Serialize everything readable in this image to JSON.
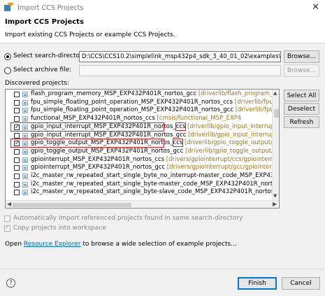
{
  "window": {
    "title": "Import CCS Projects",
    "close_glyph": "✕"
  },
  "header": {
    "title": "Import CCS Projects",
    "description": "Import existing CCS Projects or example CCS Projects."
  },
  "source": {
    "search_dir_label": "Select search-directory:",
    "search_dir_value": "D:\\CCS\\CCS10.2\\simplelink_msp432p4_sdk_3_40_01_02\\examples\\nortos\\",
    "browse_label": "Browse...",
    "archive_label": "Select archive file:",
    "archive_browse_label": "Browse...",
    "selected": "search-directory"
  },
  "projects": {
    "label": "Discovered projects:",
    "rows": [
      {
        "name": "flash_program_memory_MSP_EXP432P401R_nortos_gcc",
        "path": "[driverlib/flash_program_memory",
        "checked": false
      },
      {
        "name": "fpu_simple_floating_point_operation_MSP_EXP432P401R_nortos_ccs",
        "path": "[driverlib/fpu_simple",
        "checked": false
      },
      {
        "name": "fpu_simple_floating_point_operation_MSP_EXP432P401R_nortos_gcc",
        "path": "[driverlib/fpu_simple",
        "checked": false
      },
      {
        "name": "functional_MSP_EXP432P401R_nortos_ccs",
        "path": "[cmsis/functional_MSP_EXP4",
        "checked": false
      },
      {
        "name": "gpio_input_interrupt_MSP_EXP432P401R_nortos_",
        "highlight": "ccs",
        "path": "[driverlib/gpio_input_interrupt/ccs/gp",
        "checked": true
      },
      {
        "name": "gpio_input_interrupt_MSP_EXP432P401R_nortos_gcc",
        "path": "[driverlib/gpio_input_interrupt/gcc/",
        "checked": false
      },
      {
        "name": "gpio_toggle_output_MSP_EXP432P401R_nortos_",
        "highlight": "ccs",
        "path": "[driverlib/gpio_toggle_output/ccs/gp",
        "checked": true
      },
      {
        "name": "gpio_toggle_output_MSP_EXP432P401R_nortos_gcc",
        "path": "[driverlib/gpio_toggle_output/gcc/gp",
        "checked": false
      },
      {
        "name": "gpiointerrupt_MSP_EXP432P401R_nortos_ccs",
        "path": "[drivers/gpiointerrupt/ccs/gpiointerrupt_M",
        "checked": false
      },
      {
        "name": "gpiointerrupt_MSP_EXP432P401R_nortos_gcc",
        "path": "[drivers/gpiointerrupt/gcc/gpiointerrupt_M",
        "checked": false
      },
      {
        "name": "i2c_master_rw_repeated_start_single_byte_no_interrupt-master_code_MSP_EXP432P401R_nortos_ccs",
        "path": "",
        "checked": false
      },
      {
        "name": "i2c_master_rw_repeated_start_single_byte-master_code_MSP_EXP432P401R_nortos_ccs",
        "path": "[c",
        "checked": false
      },
      {
        "name": "i2c_master_rw_repeated_start_single_byte-slave_code_MSP_EXP432P401R_nortos_ccs",
        "path": "[dri",
        "checked": false
      }
    ],
    "select_all_label": "Select All",
    "deselect_all_label": "Deselect All",
    "refresh_label": "Refresh"
  },
  "options": {
    "auto_import_label": "Automatically import referenced projects found in same search-directory",
    "auto_import_checked": false,
    "copy_label": "Copy projects into workspace",
    "copy_checked": true
  },
  "explorer": {
    "prefix": "Open ",
    "link": "Resource Explorer",
    "suffix": " to browse a wide selection of example projects..."
  },
  "footer": {
    "help_glyph": "?",
    "finish_label": "Finish",
    "cancel_label": "Cancel"
  },
  "colors": {
    "highlight_box": "#e02020",
    "path_text": "#a0781d",
    "link": "#0066cc"
  }
}
